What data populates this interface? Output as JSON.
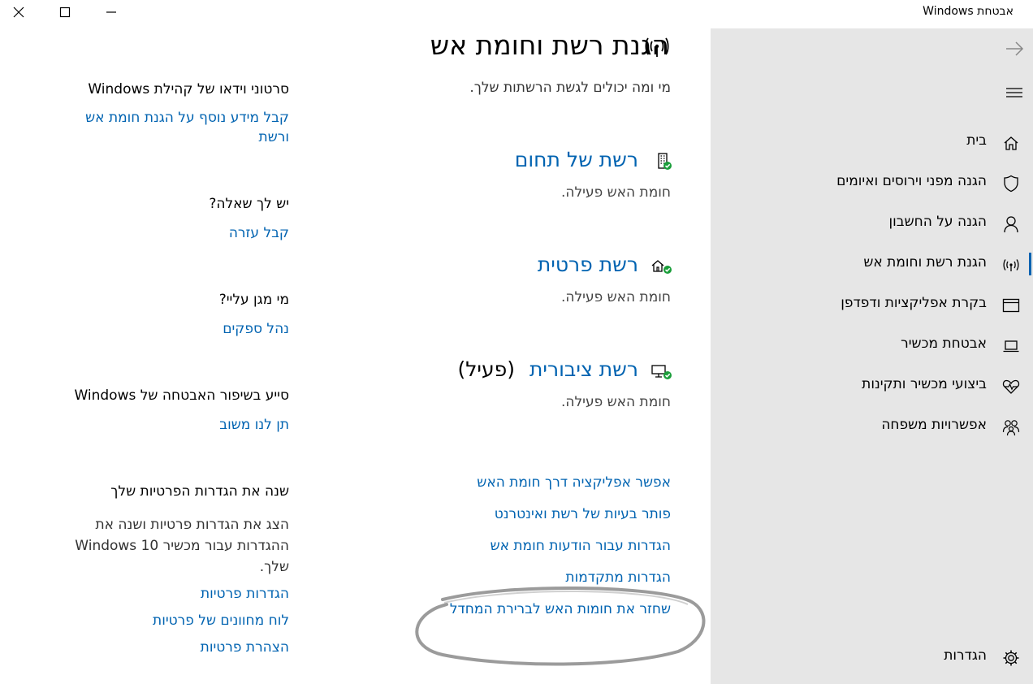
{
  "window": {
    "title": "אבטחת Windows"
  },
  "sidebar": {
    "items": [
      {
        "label": "בית",
        "icon": "home-icon"
      },
      {
        "label": "הגנה מפני וירוסים ואיומים",
        "icon": "shield-icon"
      },
      {
        "label": "הגנה על החשבון",
        "icon": "person-icon"
      },
      {
        "label": "הגנת רשת וחומת אש",
        "icon": "wifi-antenna-icon",
        "active": true
      },
      {
        "label": "בקרת אפליקציות ודפדפן",
        "icon": "browser-window-icon"
      },
      {
        "label": "אבטחת מכשיר",
        "icon": "laptop-icon"
      },
      {
        "label": "ביצועי מכשיר ותקינות",
        "icon": "heart-pulse-icon"
      },
      {
        "label": "אפשרויות משפחה",
        "icon": "family-icon"
      }
    ],
    "settings_label": "הגדרות"
  },
  "main": {
    "title": "הגנת רשת וחומת אש",
    "subtitle": "מי ומה יכולים לגשת הרשתות שלך.",
    "networks": [
      {
        "name": "רשת של תחום",
        "status": "חומת האש פעילה.",
        "active_tag": ""
      },
      {
        "name": "רשת פרטית",
        "status": "חומת האש פעילה.",
        "active_tag": ""
      },
      {
        "name": "רשת ציבורית",
        "status": "חומת האש פעילה.",
        "active_tag": "(פעיל)"
      }
    ],
    "links": [
      "אפשר אפליקציה דרך חומת האש",
      "פותר בעיות של רשת ואינטרנט",
      "הגדרות עבור הודעות חומת אש",
      "הגדרות מתקדמות",
      "שחזר את חומות האש לברירת המחדל"
    ]
  },
  "side": {
    "videos_head": "סרטוני וידאו של קהילת Windows",
    "videos_link": "קבל מידע נוסף על הגנת חומת אש ורשת",
    "question_head": "יש לך שאלה?",
    "question_link": "קבל עזרה",
    "protect_head": "מי מגן עליי?",
    "protect_link": "נהל ספקים",
    "feedback_head": "סייע בשיפור האבטחה של Windows",
    "feedback_link": "תן לנו משוב",
    "privacy_head": "שנה את הגדרות הפרטיות שלך",
    "privacy_text": "הצג את הגדרות פרטיות ושנה את ההגדרות עבור מכשיר Windows 10 שלך.",
    "privacy_links": [
      "הגדרות פרטיות",
      "לוח מחוונים של פרטיות",
      "הצהרת פרטיות"
    ]
  }
}
